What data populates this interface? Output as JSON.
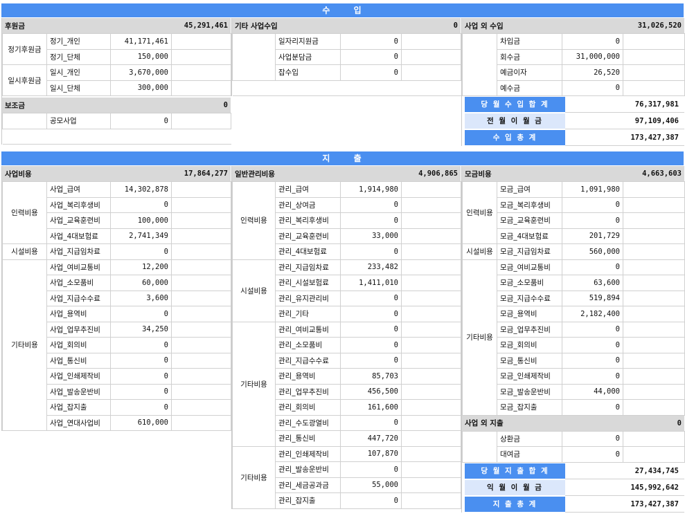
{
  "income": {
    "title": "수   입",
    "donations": {
      "label": "후원금",
      "total": "45,291,461",
      "regular_group": "정기후원금",
      "one_time_group": "일시후원금",
      "items": [
        {
          "name": "정기_개인",
          "value": "41,171,461"
        },
        {
          "name": "정기_단체",
          "value": "150,000"
        },
        {
          "name": "일시_개인",
          "value": "3,670,000"
        },
        {
          "name": "일시_단체",
          "value": "300,000"
        }
      ]
    },
    "subsidy": {
      "label": "보조금",
      "total": "0",
      "items": [
        {
          "name": "공모사업",
          "value": "0"
        }
      ]
    },
    "other_business": {
      "label": "기타 사업수입",
      "total": "0",
      "items": [
        {
          "name": "일자리지원금",
          "value": "0"
        },
        {
          "name": "사업분담금",
          "value": "0"
        },
        {
          "name": "잡수입",
          "value": "0"
        }
      ]
    },
    "non_business": {
      "label": "사업 외 수입",
      "total": "31,026,520",
      "items": [
        {
          "name": "차입금",
          "value": "0"
        },
        {
          "name": "회수금",
          "value": "31,000,000"
        },
        {
          "name": "예금이자",
          "value": "26,520"
        },
        {
          "name": "예수금",
          "value": "0"
        }
      ]
    },
    "summary": [
      {
        "label": "당 월 수 입 합 계",
        "value": "76,317,981"
      },
      {
        "label": "전 월 이 월 금",
        "value": "97,109,406"
      },
      {
        "label": "수 입 총 계",
        "value": "173,427,387"
      }
    ]
  },
  "expense": {
    "title": "지   출",
    "business": {
      "label": "사업비용",
      "total": "17,864,277",
      "groups": {
        "personnel": "인력비용",
        "facility": "시설비용",
        "other": "기타비용"
      },
      "items": [
        {
          "name": "사업_급여",
          "value": "14,302,878"
        },
        {
          "name": "사업_복리후생비",
          "value": "0"
        },
        {
          "name": "사업_교육훈련비",
          "value": "100,000"
        },
        {
          "name": "사업_4대보험료",
          "value": "2,741,349"
        },
        {
          "name": "사업_지급임차료",
          "value": "0"
        },
        {
          "name": "사업_여비교통비",
          "value": "12,200"
        },
        {
          "name": "사업_소모품비",
          "value": "60,000"
        },
        {
          "name": "사업_지급수수료",
          "value": "3,600"
        },
        {
          "name": "사업_용역비",
          "value": "0"
        },
        {
          "name": "사업_업무추진비",
          "value": "34,250"
        },
        {
          "name": "사업_회의비",
          "value": "0"
        },
        {
          "name": "사업_통신비",
          "value": "0"
        },
        {
          "name": "사업_인쇄제작비",
          "value": "0"
        },
        {
          "name": "사업_발송운반비",
          "value": "0"
        },
        {
          "name": "사업_잡지출",
          "value": "0"
        },
        {
          "name": "사업_연대사업비",
          "value": "610,000"
        }
      ]
    },
    "admin": {
      "label": "일반관리비용",
      "total": "4,906,865",
      "groups": {
        "personnel": "인력비용",
        "facility": "시설비용",
        "other1": "기타비용",
        "other2": "기타비용"
      },
      "items": [
        {
          "name": "관리_급여",
          "value": "1,914,980"
        },
        {
          "name": "관리_상여금",
          "value": "0"
        },
        {
          "name": "관리_복리후생비",
          "value": "0"
        },
        {
          "name": "관리_교육훈련비",
          "value": "33,000"
        },
        {
          "name": "관리_4대보험료",
          "value": "0"
        },
        {
          "name": "관리_지급임차료",
          "value": "233,482"
        },
        {
          "name": "관리_시설보험료",
          "value": "1,411,010"
        },
        {
          "name": "관리_유지관리비",
          "value": "0"
        },
        {
          "name": "관리_기타",
          "value": "0"
        },
        {
          "name": "관리_여비교통비",
          "value": "0"
        },
        {
          "name": "관리_소모품비",
          "value": "0"
        },
        {
          "name": "관리_지급수수료",
          "value": "0"
        },
        {
          "name": "관리_용역비",
          "value": "85,703"
        },
        {
          "name": "관리_업무추진비",
          "value": "456,500"
        },
        {
          "name": "관리_회의비",
          "value": "161,600"
        },
        {
          "name": "관리_수도광열비",
          "value": "0"
        },
        {
          "name": "관리_통신비",
          "value": "447,720"
        },
        {
          "name": "관리_인쇄제작비",
          "value": "107,870"
        },
        {
          "name": "관리_발송운반비",
          "value": "0"
        },
        {
          "name": "관리_세금공과금",
          "value": "55,000"
        },
        {
          "name": "관리_잡지출",
          "value": "0"
        }
      ]
    },
    "fundraising": {
      "label": "모금비용",
      "total": "4,663,603",
      "groups": {
        "personnel": "인력비용",
        "facility": "시설비용",
        "other": "기타비용"
      },
      "items": [
        {
          "name": "모금_급여",
          "value": "1,091,980"
        },
        {
          "name": "모금_복리후생비",
          "value": "0"
        },
        {
          "name": "모금_교육훈련비",
          "value": "0"
        },
        {
          "name": "모금_4대보험료",
          "value": "201,729"
        },
        {
          "name": "모금_지급임차료",
          "value": "560,000"
        },
        {
          "name": "모금_여비교통비",
          "value": "0"
        },
        {
          "name": "모금_소모품비",
          "value": "63,600"
        },
        {
          "name": "모금_지급수수료",
          "value": "519,894"
        },
        {
          "name": "모금_용역비",
          "value": "2,182,400"
        },
        {
          "name": "모금_업무추진비",
          "value": "0"
        },
        {
          "name": "모금_회의비",
          "value": "0"
        },
        {
          "name": "모금_통신비",
          "value": "0"
        },
        {
          "name": "모금_인쇄제작비",
          "value": "0"
        },
        {
          "name": "모금_발송운반비",
          "value": "44,000"
        },
        {
          "name": "모금_잡지출",
          "value": "0"
        }
      ]
    },
    "non_business": {
      "label": "사업 외 지출",
      "total": "0",
      "items": [
        {
          "name": "상환금",
          "value": "0"
        },
        {
          "name": "대여금",
          "value": "0"
        }
      ]
    },
    "summary": [
      {
        "label": "당 월 지 출 합 계",
        "value": "27,434,745"
      },
      {
        "label": "익 월 이 월 금",
        "value": "145,992,642"
      },
      {
        "label": "지 출 총 계",
        "value": "173,427,387"
      }
    ]
  }
}
